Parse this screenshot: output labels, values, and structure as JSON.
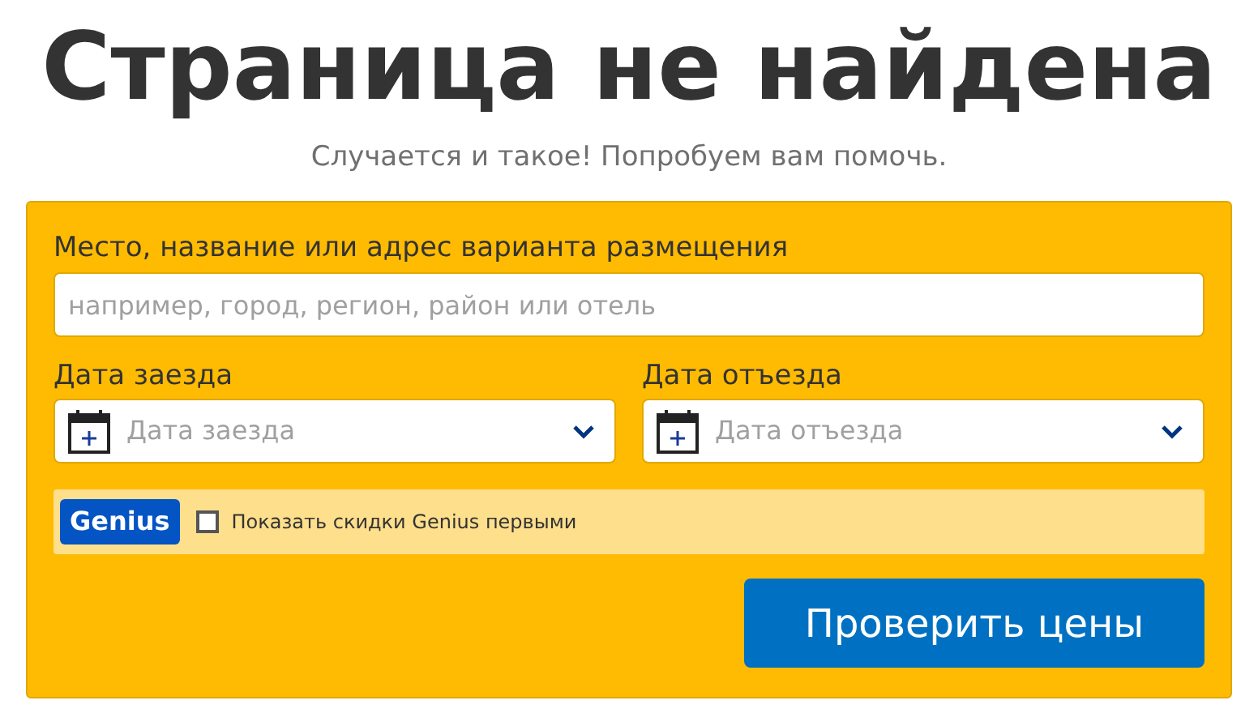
{
  "title": "Страница не найдена",
  "subtitle": "Случается и такое! Попробуем вам помочь.",
  "search": {
    "label": "Место, название или адрес варианта размещения",
    "placeholder": "например, город, регион, район или отель"
  },
  "dates": [
    {
      "label": "Дата заезда",
      "placeholder": "Дата заезда"
    },
    {
      "label": "Дата отъезда",
      "placeholder": "Дата отъезда"
    }
  ],
  "genius": {
    "logo": "Genius",
    "label": "Показать скидки Genius первыми",
    "checked": false
  },
  "submit": "Проверить цены"
}
